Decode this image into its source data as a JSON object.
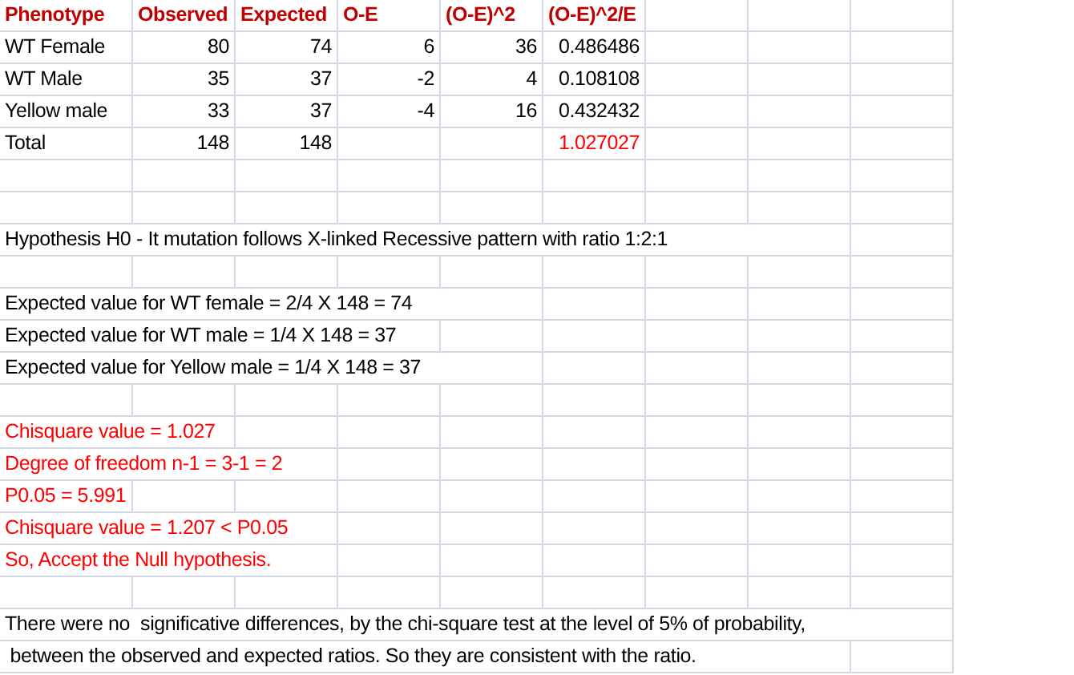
{
  "table": {
    "columns": [
      "Phenotype",
      "Observed",
      "Expected",
      "O-E",
      "(O-E)^2",
      "(O-E)^2/E"
    ],
    "rows": [
      {
        "cells": [
          "WT Female",
          "80",
          "74",
          "6",
          "36",
          "0.486486"
        ]
      },
      {
        "cells": [
          "WT Male",
          "35",
          "37",
          "-2",
          "4",
          "0.108108"
        ]
      },
      {
        "cells": [
          "Yellow male",
          "33",
          "37",
          "-4",
          "16",
          "0.432432"
        ]
      }
    ],
    "total": {
      "label": "Total",
      "observed": "148",
      "expected": "148",
      "chi_square": "1.027027"
    }
  },
  "notes": [
    {
      "text": "Hypothesis H0 - It mutation follows X-linked Recessive pattern with ratio 1:2:1",
      "kind": "normal"
    },
    {
      "text": "Expected value for WT female = 2/4 X 148 = 74",
      "kind": "normal"
    },
    {
      "text": "Expected value for WT male = 1/4 X 148 = 37",
      "kind": "normal"
    },
    {
      "text": "Expected value for Yellow male = 1/4 X 148 = 37",
      "kind": "normal"
    },
    {
      "text": "Chisquare value = 1.027",
      "kind": "highlight"
    },
    {
      "text": "Degree of freedom n-1 = 3-1 = 2",
      "kind": "highlight"
    },
    {
      "text": "P0.05 = 5.991",
      "kind": "highlight"
    },
    {
      "text": "Chisquare value = 1.207 < P0.05",
      "kind": "highlight"
    },
    {
      "text": "So, Accept the Null hypothesis.",
      "kind": "highlight"
    },
    {
      "text": "There were no  significative differences, by the chi-square test at the level of 5% of probability,",
      "kind": "normal"
    },
    {
      "text": " between the observed and expected ratios. So they are consistent with the ratio.",
      "kind": "normal"
    }
  ]
}
